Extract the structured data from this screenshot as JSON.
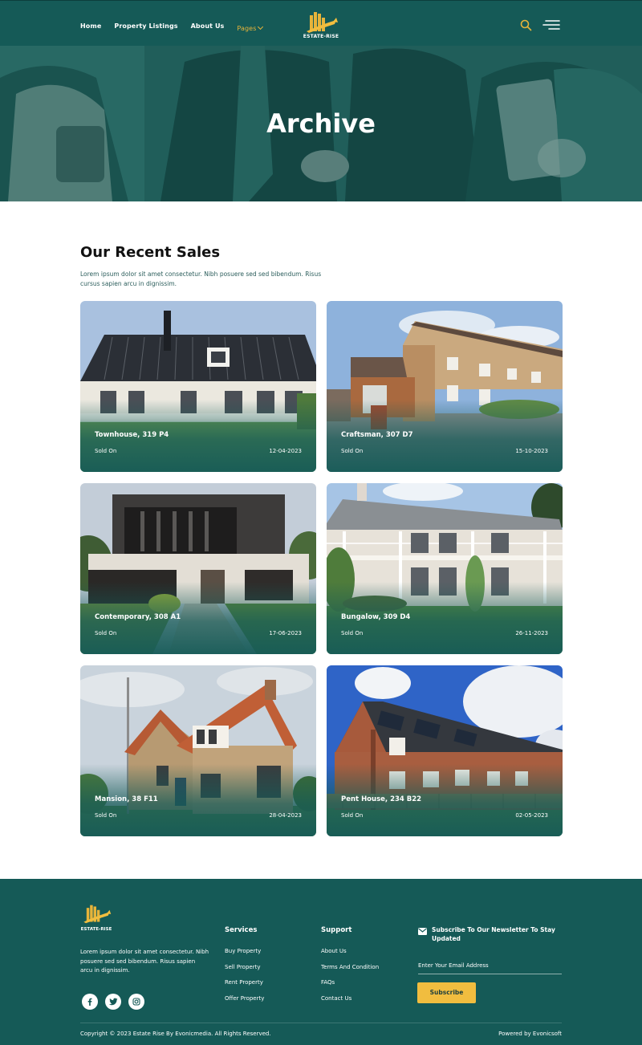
{
  "header": {
    "nav": [
      {
        "label": "Home"
      },
      {
        "label": "Property Listings"
      },
      {
        "label": "About Us"
      },
      {
        "label": "Pages"
      }
    ],
    "logo_text": "ESTATE-RISE",
    "icons": {
      "search": "search-icon",
      "menu": "hamburger-menu-icon"
    }
  },
  "hero": {
    "title": "Archive"
  },
  "section": {
    "title": "Our Recent Sales",
    "description": "Lorem ipsum dolor sit amet consectetur. Nibh posuere sed sed bibendum. Risus cursus sapien arcu in dignissim."
  },
  "cards": [
    {
      "title": "Townhouse, 319 P4",
      "status": "Sold On",
      "date": "12-04-2023"
    },
    {
      "title": "Craftsman, 307 D7",
      "status": "Sold On",
      "date": "15-10-2023"
    },
    {
      "title": "Contemporary, 308 A1",
      "status": "Sold On",
      "date": "17-06-2023"
    },
    {
      "title": "Bungalow, 309 D4",
      "status": "Sold On",
      "date": "26-11-2023"
    },
    {
      "title": "Mansion, 38 F11",
      "status": "Sold On",
      "date": "28-04-2023"
    },
    {
      "title": "Pent House, 234 B22",
      "status": "Sold On",
      "date": "02-05-2023"
    }
  ],
  "footer": {
    "logo_text": "ESTATE-RISE",
    "description": "Lorem ipsum dolor sit amet consectetur. Nibh posuere sed sed bibendum. Risus sapien arcu in dignissim.",
    "services": {
      "title": "Services",
      "links": [
        "Buy Property",
        "Sell Property",
        "Rent Property",
        "Offer Property"
      ]
    },
    "support": {
      "title": "Support",
      "links": [
        "About Us",
        "Terms And Condition",
        "FAQs",
        "Contact Us"
      ]
    },
    "newsletter": {
      "title": "Subscribe To Our Newsletter To Stay Updated",
      "placeholder": "Enter Your Email Address",
      "button": "Subscribe"
    },
    "socials": [
      "facebook-icon",
      "twitter-icon",
      "instagram-icon"
    ],
    "copyright": "Copyright © 2023 Estate Rise By Evonicmedia. All Rights Reserved.",
    "powered": "Powered by Evonicsoft"
  },
  "colors": {
    "primary": "#155a57",
    "accent": "#f1bd3f",
    "nav_active": "#e7b43a"
  }
}
